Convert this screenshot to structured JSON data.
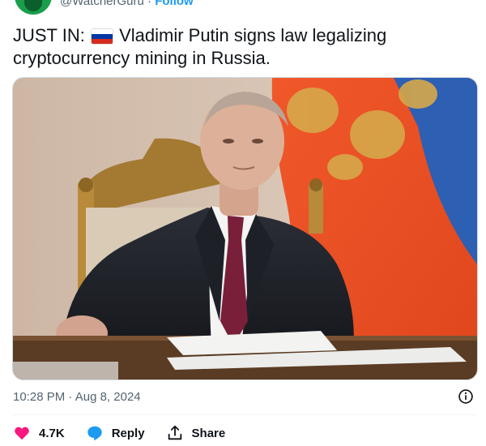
{
  "header": {
    "handle": "@WatcherGuru",
    "separator": "·",
    "follow_label": "Follow"
  },
  "tweet": {
    "prefix": "JUST IN:",
    "flag_icon": "russia-flag-icon",
    "body": "Vladimir Putin signs law legalizing cryptocurrency mining in Russia."
  },
  "meta": {
    "time": "10:28 PM",
    "separator": "·",
    "date": "Aug 8, 2024"
  },
  "actions": {
    "likes_count": "4.7K",
    "reply_label": "Reply",
    "share_label": "Share"
  },
  "colors": {
    "like": "#f91880",
    "reply": "#1d9bf0",
    "follow": "#1d9bf0",
    "flag": [
      "#ffffff",
      "#0039a6",
      "#d52b1e"
    ]
  }
}
